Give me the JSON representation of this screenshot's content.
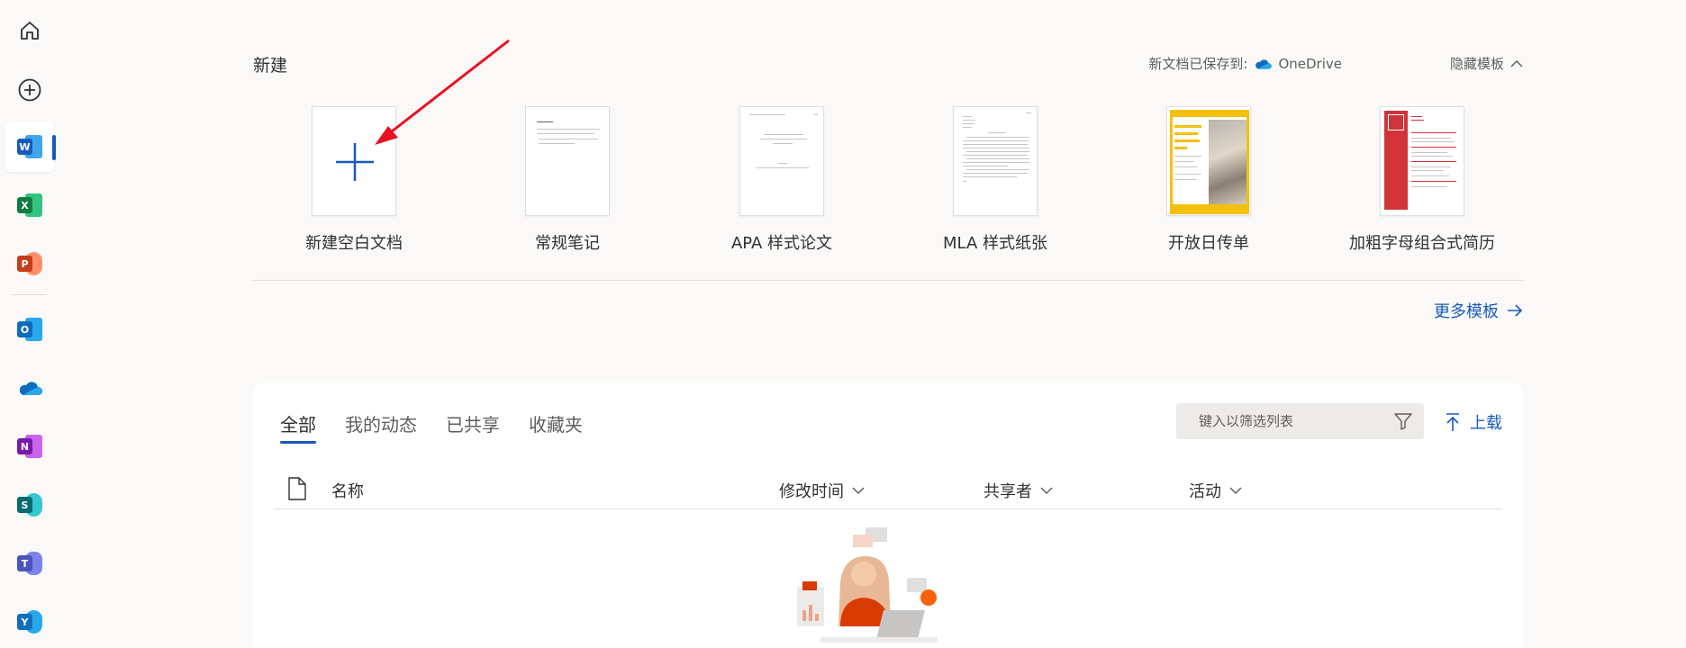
{
  "rail": {
    "items": [
      {
        "name": "home-icon"
      },
      {
        "name": "create-icon"
      },
      {
        "name": "word-app-icon",
        "letter": "W",
        "color": "#185abd",
        "back": "#41a5ee"
      },
      {
        "name": "excel-app-icon",
        "letter": "X",
        "color": "#107c41",
        "back": "#33c481"
      },
      {
        "name": "powerpoint-app-icon",
        "letter": "P",
        "color": "#c43e1c",
        "back": "#ff8f6b"
      },
      {
        "name": "outlook-app-icon",
        "letter": "O",
        "color": "#0f6cbd",
        "back": "#28a8ea"
      },
      {
        "name": "onedrive-app-icon"
      },
      {
        "name": "onenote-app-icon",
        "letter": "N",
        "color": "#7719aa",
        "back": "#ca64ea"
      },
      {
        "name": "sharepoint-app-icon",
        "letter": "S",
        "color": "#036c70",
        "back": "#37c6d0"
      },
      {
        "name": "teams-app-icon",
        "letter": "T",
        "color": "#4b53bc",
        "back": "#7b83eb"
      },
      {
        "name": "yammer-app-icon",
        "letter": "Y",
        "color": "#106ebe",
        "back": "#28a8ea"
      }
    ]
  },
  "header": {
    "title": "新建",
    "save_note": "新文档已保存到:",
    "onedrive": "OneDrive",
    "hide_templates": "隐藏模板"
  },
  "templates": [
    {
      "label": "新建空白文档"
    },
    {
      "label": "常规笔记"
    },
    {
      "label": "APA 样式论文"
    },
    {
      "label": "MLA 样式纸张"
    },
    {
      "label": "开放日传单"
    },
    {
      "label": "加粗字母组合式简历"
    }
  ],
  "more_templates": "更多模板",
  "files": {
    "tabs": [
      {
        "label": "全部",
        "active": true
      },
      {
        "label": "我的动态",
        "active": false
      },
      {
        "label": "已共享",
        "active": false
      },
      {
        "label": "收藏夹",
        "active": false
      }
    ],
    "filter_placeholder": "键入以筛选列表",
    "upload": "上载",
    "columns": {
      "name": "名称",
      "modified": "修改时间",
      "sharer": "共享者",
      "activity": "活动"
    }
  },
  "colors": {
    "accent": "#185abd",
    "annotation_arrow": "#e81123"
  }
}
